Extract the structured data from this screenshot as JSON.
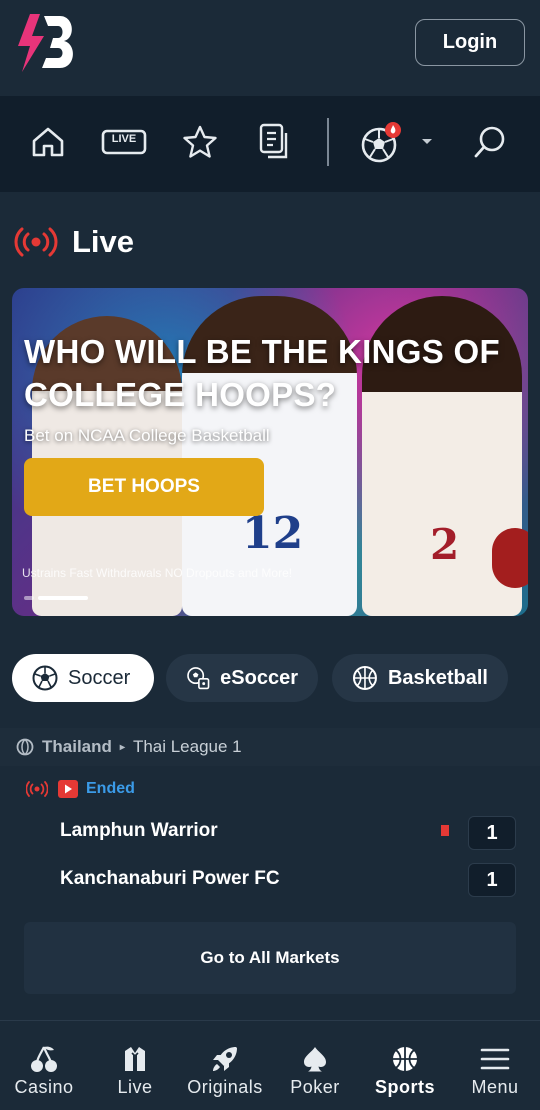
{
  "header": {
    "login_label": "Login",
    "brand_color": "#e8347a"
  },
  "nav": {
    "live_badge": "LIVE",
    "notification_badge_color": "#e53935",
    "icons": [
      "home-icon",
      "live-icon",
      "star-icon",
      "betslip-icon",
      "soccer-ball-icon",
      "chevron-down-icon",
      "search-icon"
    ]
  },
  "live_section": {
    "title": "Live",
    "accent_color": "#e53935"
  },
  "banner": {
    "headline": "WHO WILL BE THE KINGS OF COLLEGE HOOPS?",
    "subtitle": "Bet on NCAA College Basketball",
    "cta_label": "BET HOOPS",
    "fine_print": "Ustrains Fast Withdrawals NO Dropouts and More!",
    "cta_color": "#e2a817"
  },
  "sport_tabs": [
    {
      "label": "Soccer",
      "icon": "soccer-ball-icon",
      "active": true
    },
    {
      "label": "eSoccer",
      "icon": "esoccer-icon",
      "active": false
    },
    {
      "label": "Basketball",
      "icon": "basketball-icon",
      "active": false
    }
  ],
  "league": {
    "country": "Thailand",
    "name": "Thai League 1"
  },
  "match": {
    "status": "Ended",
    "home_team": "Lamphun Warrior",
    "home_score": "1",
    "away_team": "Kanchanaburi Power FC",
    "away_score": "1",
    "markets_label": "Go to All Markets",
    "status_color": "#3b9be8"
  },
  "bottom_nav": [
    {
      "label": "Casino",
      "icon": "cherries-icon",
      "active": false
    },
    {
      "label": "Live",
      "icon": "dealer-icon",
      "active": false
    },
    {
      "label": "Originals",
      "icon": "rocket-icon",
      "active": false
    },
    {
      "label": "Poker",
      "icon": "spade-icon",
      "active": false
    },
    {
      "label": "Sports",
      "icon": "basketball-icon",
      "active": true
    },
    {
      "label": "Menu",
      "icon": "hamburger-menu-icon",
      "active": false
    }
  ]
}
